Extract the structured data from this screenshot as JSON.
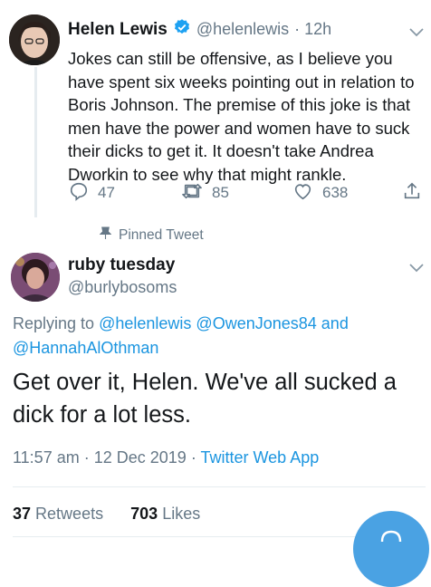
{
  "tweet1": {
    "name": "Helen Lewis",
    "handle": "@helenlewis",
    "time": "· 12h",
    "text": "Jokes can still be offensive, as I believe you have spent six weeks pointing out in relation to Boris Johnson. The premise of this joke is that men have the power and women have to suck their dicks to get it. It doesn't take Andrea Dworkin to see why that might rankle.",
    "replies": "47",
    "retweets": "85",
    "likes": "638",
    "icons": [
      "reply-icon",
      "retweet-icon",
      "like-icon",
      "share-icon",
      "verified-icon",
      "chevron-down-icon"
    ]
  },
  "pinned_label": "Pinned Tweet",
  "tweet2": {
    "name": "ruby tuesday",
    "handle": "@burlybosoms",
    "replying_prefix": "Replying to",
    "mentions": [
      "@helenlewis",
      "@OwenJones84",
      "and",
      "@HannahAlOthman"
    ],
    "text": "Get over it, Helen. We've all sucked a dick for a lot less.",
    "time": "11:57 am",
    "date": "12 Dec 2019",
    "source": "Twitter Web App",
    "retweet_count": "37",
    "retweet_label": "Retweets",
    "like_count": "703",
    "like_label": "Likes"
  },
  "colors": {
    "link": "#1b95e0",
    "muted": "#657786",
    "text": "#14171a",
    "fab": "#4aa2e3"
  }
}
